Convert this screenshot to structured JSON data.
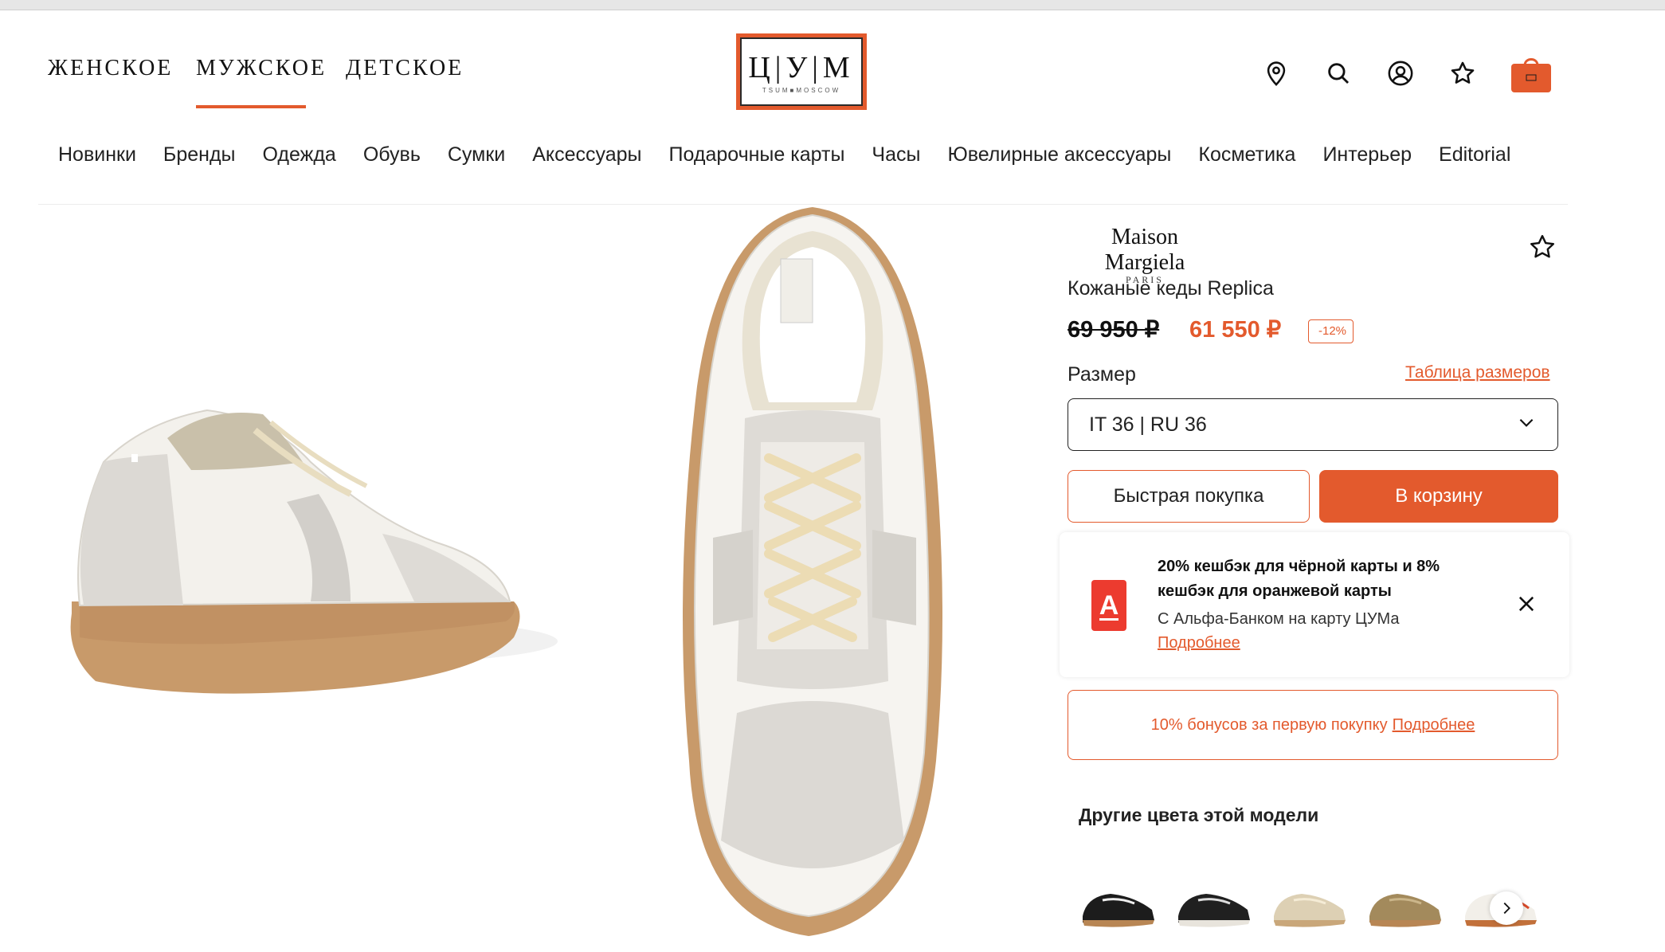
{
  "header": {
    "gender_tabs": [
      {
        "label": "ЖЕНСКОЕ",
        "active": false
      },
      {
        "label": "МУЖСКОЕ",
        "active": true
      },
      {
        "label": "ДЕТСКОЕ",
        "active": false
      }
    ],
    "logo": {
      "main": "Ц|У|М",
      "sub": "TSUM■MOSCOW"
    },
    "icons": [
      "location-pin-icon",
      "search-icon",
      "account-icon",
      "favorites-star-icon",
      "shopping-bag-icon"
    ],
    "accent_color": "#e35a2d"
  },
  "categories": [
    "Новинки",
    "Бренды",
    "Одежда",
    "Обувь",
    "Сумки",
    "Аксессуары",
    "Подарочные карты",
    "Часы",
    "Ювелирные аксессуары",
    "Косметика",
    "Интерьер",
    "Editorial"
  ],
  "product": {
    "brand_name": "Maison Margiela",
    "brand_sub": "PARIS",
    "name": "Кожаные кеды Replica",
    "old_price": "69 950 ₽",
    "new_price": "61 550 ₽",
    "discount": "-12%",
    "size_label": "Размер",
    "size_table_link": "Таблица размеров",
    "selected_size": "IT 36 | RU 36",
    "quick_buy_label": "Быстрая покупка",
    "add_to_cart_label": "В корзину"
  },
  "promo": {
    "bank_logo_letter": "А",
    "title": "20% кешбэк для чёрной карты и 8% кешбэк для оранжевой карты",
    "subtitle": "С Альфа-Банком на карту ЦУМа",
    "more_link": "Подробнее"
  },
  "bonus": {
    "text": "10% бонусов за первую покупку",
    "link": "Подробнее"
  },
  "other_colors": {
    "title": "Другие цвета этой модели",
    "swatches": [
      "black-sneaker",
      "black-sneaker-white-sole",
      "beige-sneaker",
      "olive-sneaker",
      "white-tan-sneaker"
    ]
  }
}
